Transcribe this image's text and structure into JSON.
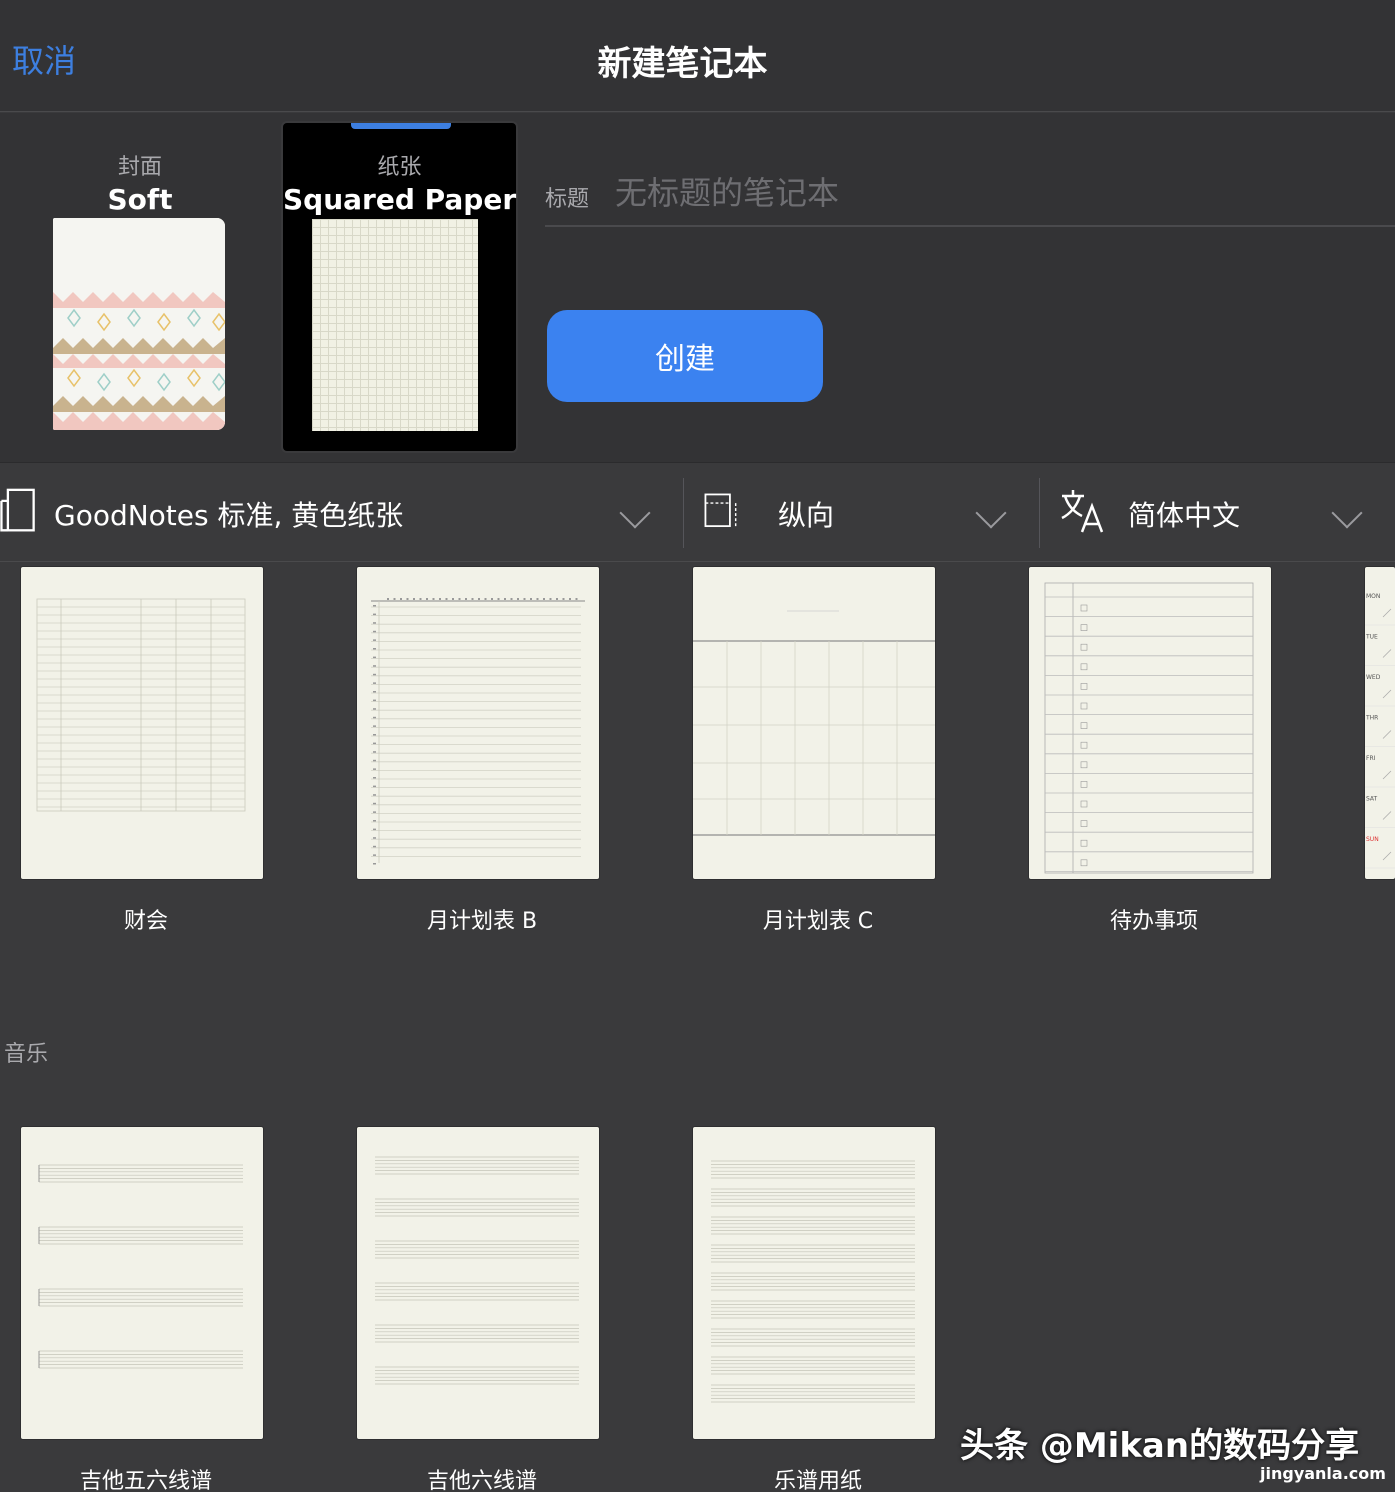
{
  "header": {
    "cancel_label": "取消",
    "title": "新建笔记本"
  },
  "cover": {
    "caption": "封面",
    "value": "Soft"
  },
  "paper": {
    "caption": "纸张",
    "value": "Squared Paper"
  },
  "title_field": {
    "label": "标题",
    "placeholder": "无标题的笔记本"
  },
  "create_label": "创建",
  "filters": {
    "template_set": "GoodNotes 标准, 黄色纸张",
    "orientation": "纵向",
    "language": "简体中文"
  },
  "templates_row1": [
    {
      "label": "财会"
    },
    {
      "label": "月计划表 B"
    },
    {
      "label": "月计划表 C"
    },
    {
      "label": "待办事项"
    }
  ],
  "music_section": {
    "title": "音乐",
    "templates": [
      {
        "label": "吉他五六线谱"
      },
      {
        "label": "吉他六线谱"
      },
      {
        "label": "乐谱用纸"
      }
    ]
  },
  "weekday_partial": [
    "MON",
    "TUE",
    "WED",
    "THR",
    "FRI",
    "SAT",
    "SUN"
  ],
  "watermark": {
    "text": "头条 @Mikan的数码分享",
    "site": "jingyanla.com"
  },
  "colors": {
    "accent": "#3b82f0",
    "link": "#3d7fe0",
    "background": "#3a3a3c"
  }
}
